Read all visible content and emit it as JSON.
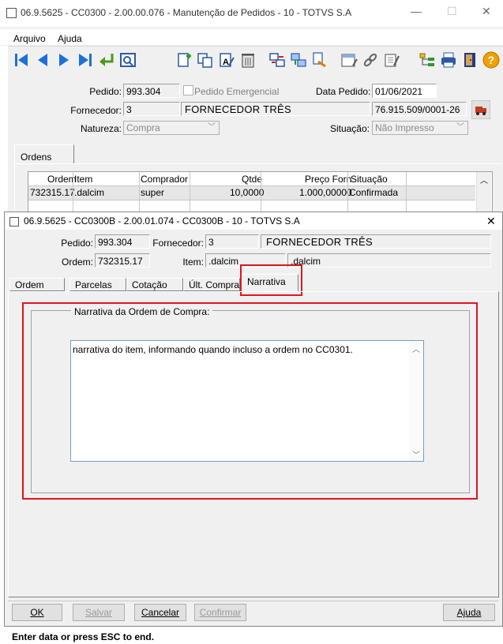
{
  "main": {
    "title": "06.9.5625 - CC0300 - 2.00.00.076 - Manutenção de Pedidos - 10 - TOTVS S.A",
    "menu": [
      "Arquivo",
      "Ajuda"
    ],
    "pedido_label": "Pedido:",
    "pedido_value": "993.304",
    "emergencial_label": "Pedido Emergencial",
    "data_pedido_label": "Data Pedido:",
    "data_pedido_value": "01/06/2021",
    "fornecedor_label": "Fornecedor:",
    "fornecedor_code": "3",
    "fornecedor_name": "FORNECEDOR TRÊS",
    "fornecedor_cnpj": "76.915.509/0001-26",
    "natureza_label": "Natureza:",
    "natureza_value": "Compra",
    "situacao_label": "Situação:",
    "situacao_value": "Não Impresso",
    "tab_ordens": "Ordens",
    "grid": {
      "headers": [
        "Ordem",
        "Item",
        "Comprador",
        "Qtde",
        "Preço Forn",
        "Situação"
      ],
      "row": [
        "732315.17",
        ".dalcim",
        "super",
        "10,0000",
        "1.000,00000",
        "Confirmada"
      ]
    }
  },
  "dialog": {
    "title": "06.9.5625 - CC0300B - 2.00.01.074 - CC0300B - 10 - TOTVS S.A",
    "close": "✕",
    "pedido_label": "Pedido:",
    "pedido_value": "993.304",
    "fornecedor_label": "Fornecedor:",
    "fornecedor_code": "3",
    "fornecedor_name": "FORNECEDOR TRÊS",
    "ordem_label": "Ordem:",
    "ordem_value": "732315.17",
    "item_label": "Item:",
    "item_value": ".dalcim",
    "item_desc": ".dalcim",
    "tabs": [
      "Ordem",
      "Parcelas",
      "Cotação",
      "Últ. Compra",
      "Narrativa"
    ],
    "group_title": "Narrativa da Ordem de Compra:",
    "narrative": "narrativa do item, informando quando incluso a ordem no CC0301.",
    "buttons": {
      "ok": "OK",
      "salvar": "Salvar",
      "cancelar": "Cancelar",
      "confirmar": "Confirmar",
      "ajuda": "Ajuda"
    }
  },
  "status_bar": "Enter data or press ESC to end.",
  "colors": {
    "highlight_red": "#e0141e",
    "nav_blue": "#1e6fd9"
  }
}
